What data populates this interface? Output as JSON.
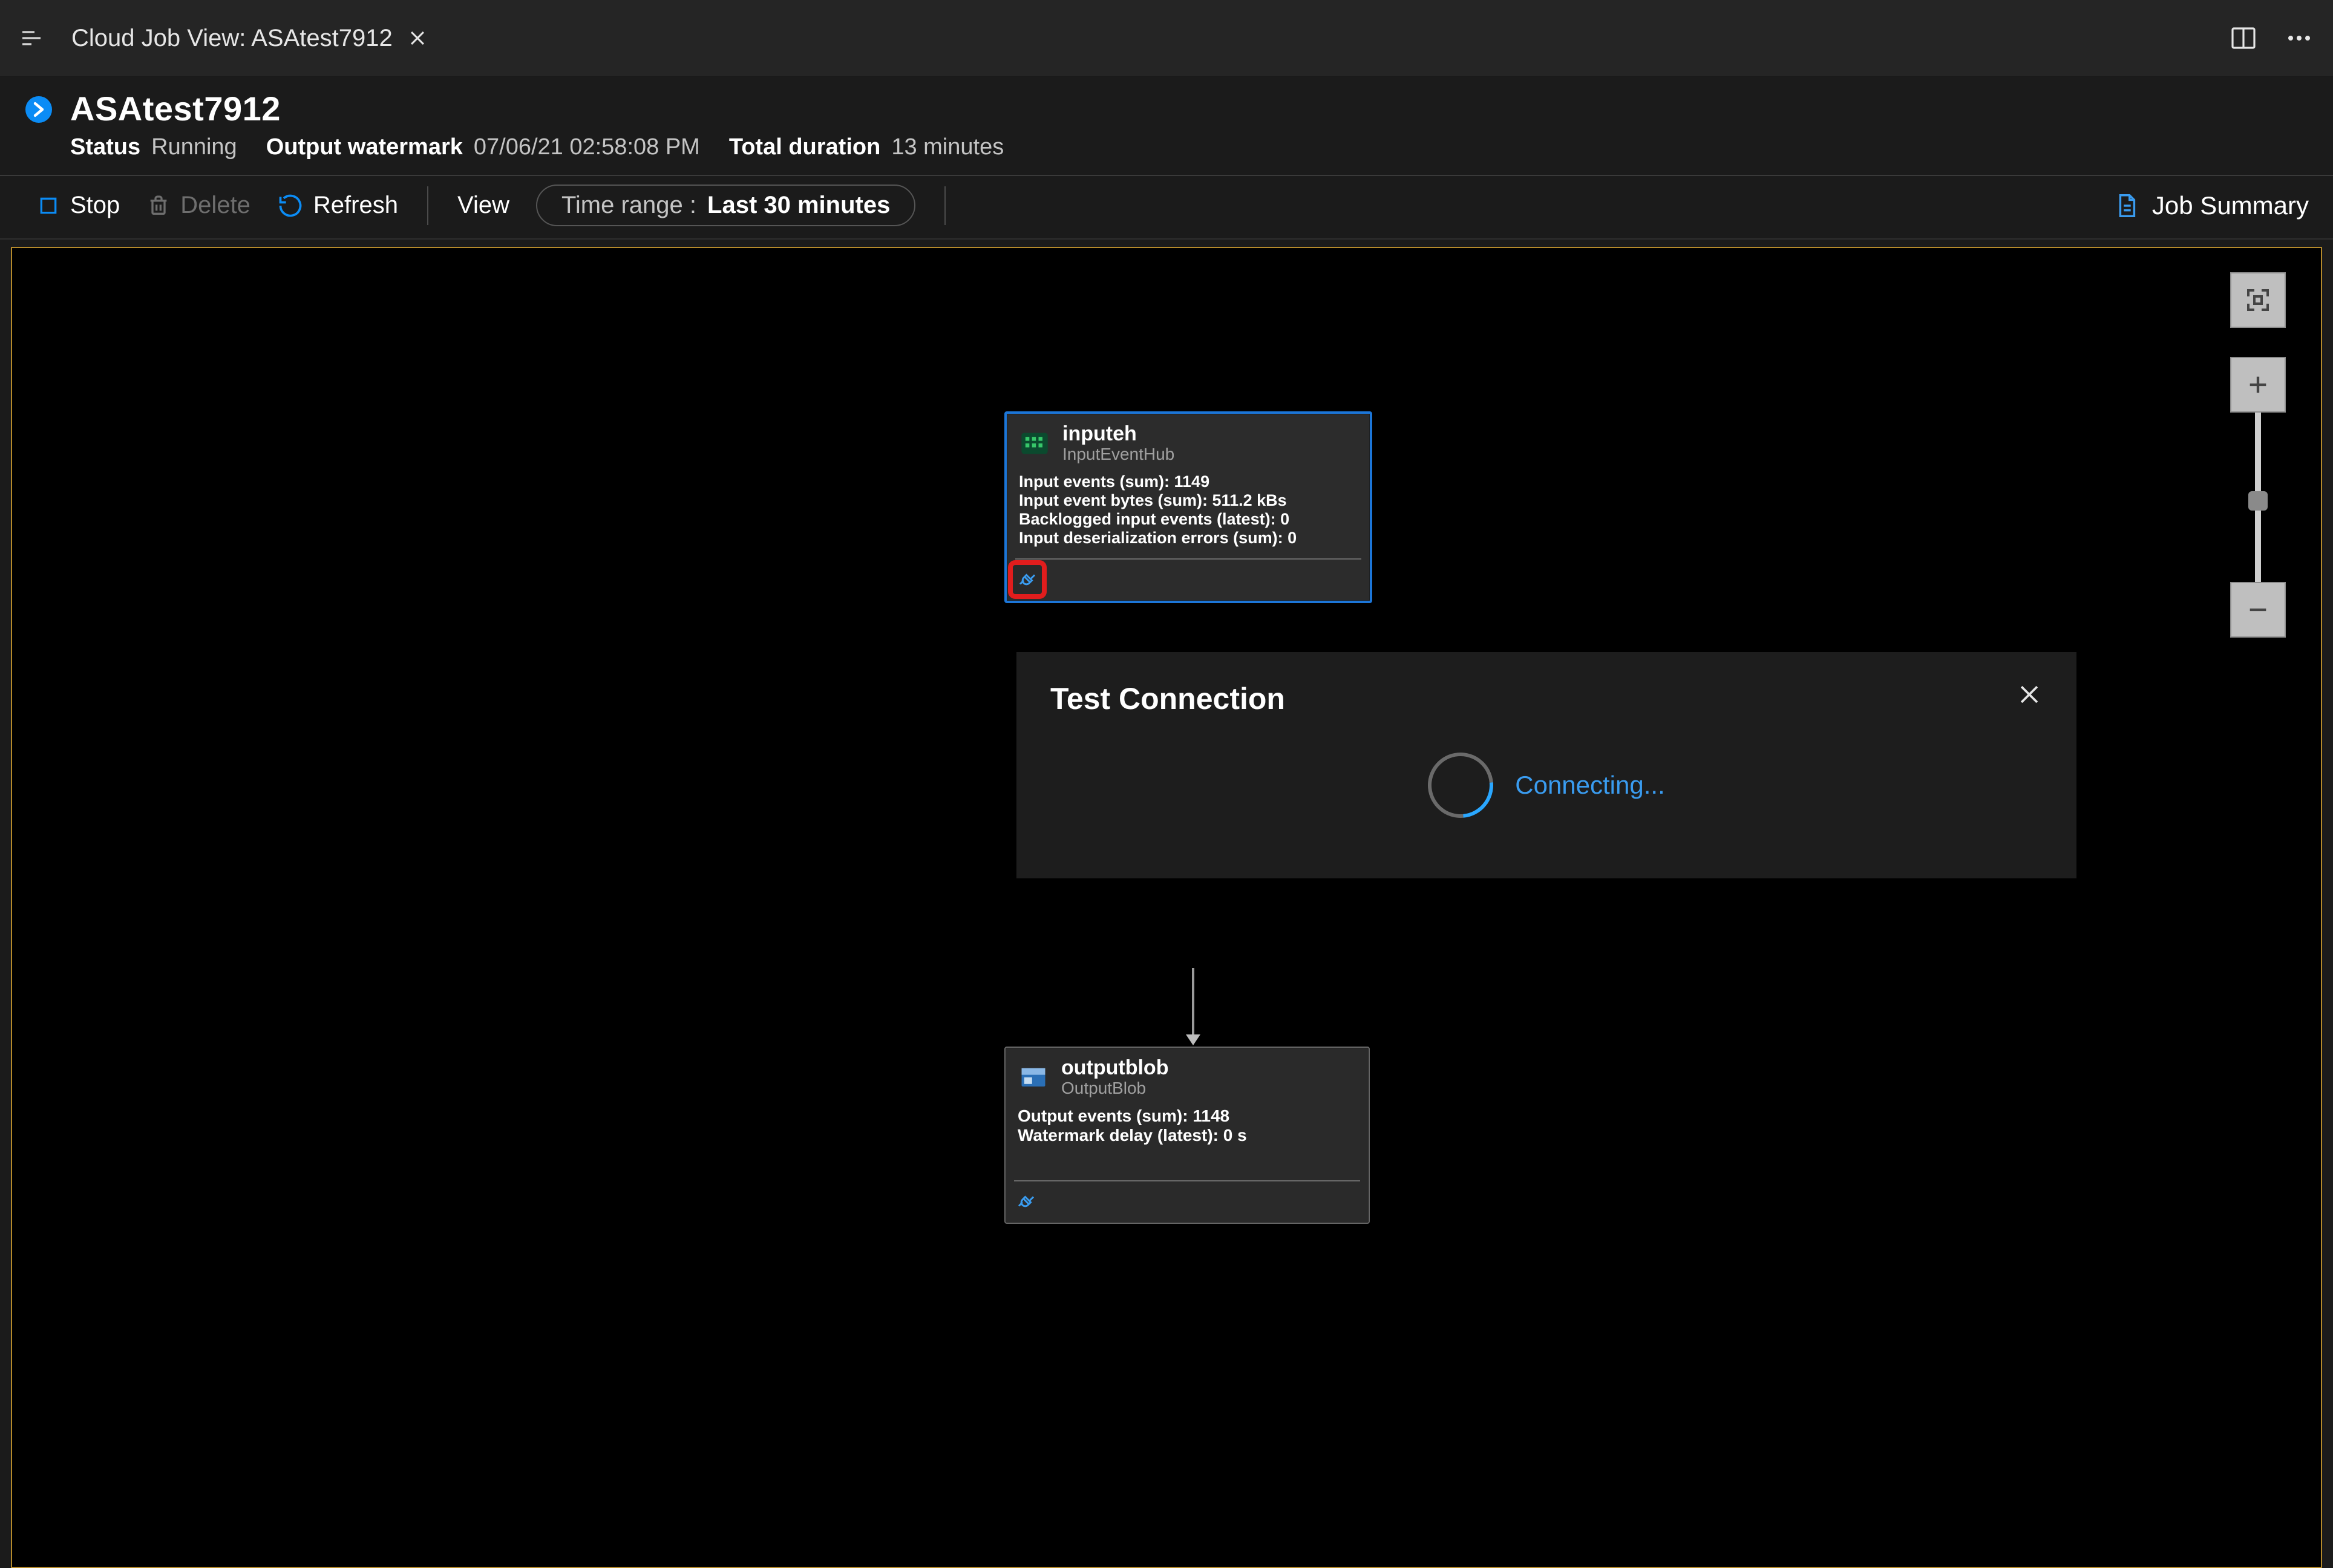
{
  "tab": {
    "label": "Cloud Job View: ASAtest7912"
  },
  "header": {
    "title": "ASAtest7912",
    "status_label": "Status",
    "status_value": "Running",
    "watermark_label": "Output watermark",
    "watermark_value": "07/06/21 02:58:08 PM",
    "duration_label": "Total duration",
    "duration_value": "13 minutes"
  },
  "toolbar": {
    "stop": "Stop",
    "delete": "Delete",
    "refresh": "Refresh",
    "view": "View",
    "time_range_label": "Time range :",
    "time_range_value": "Last 30 minutes",
    "job_summary": "Job Summary"
  },
  "diagram": {
    "input": {
      "name": "inputeh",
      "type": "InputEventHub",
      "metrics": [
        "Input events (sum): 1149",
        "Input event bytes (sum): 511.2 kBs",
        "Backlogged input events (latest): 0",
        "Input deserialization errors (sum): 0"
      ]
    },
    "output": {
      "name": "outputblob",
      "type": "OutputBlob",
      "metrics": [
        "Output events (sum): 1148",
        "Watermark delay (latest): 0 s"
      ]
    }
  },
  "dialog": {
    "title": "Test Connection",
    "status": "Connecting..."
  }
}
